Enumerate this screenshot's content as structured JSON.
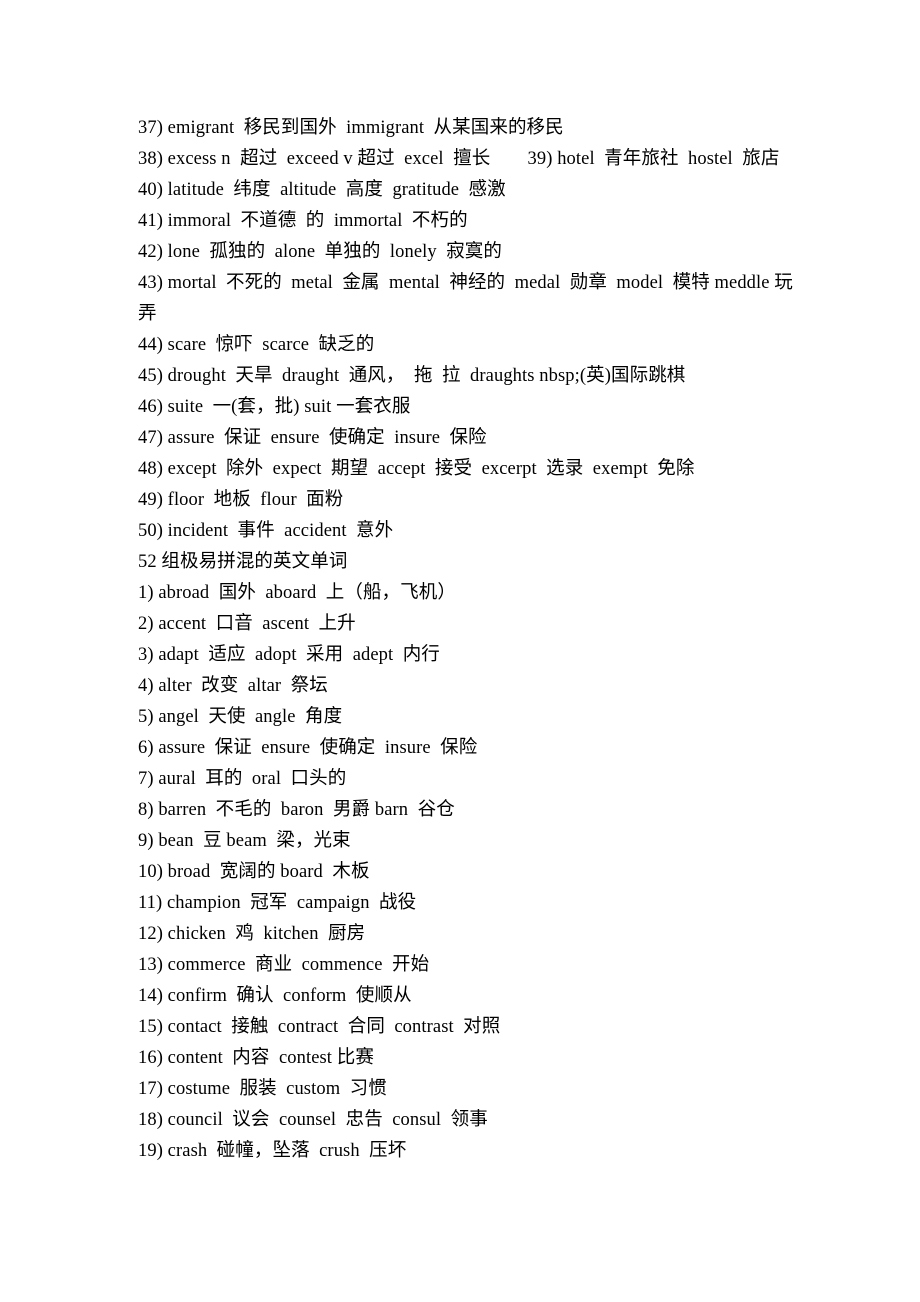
{
  "document": {
    "type": "vocabulary-study-notes",
    "language": "zh-CN/en",
    "sections": [
      {
        "id": "section-continued",
        "heading": null,
        "entries": [
          {
            "num": "37)",
            "text": "37) emigrant  移民到国外  immigrant  从某国来的移民"
          },
          {
            "num": "38)",
            "text": "38) excess n  超过  exceed v 超过  excel  擅长　　39) hotel  青年旅社  hostel  旅店"
          },
          {
            "num": "40)",
            "text": "40) latitude  纬度  altitude  高度  gratitude  感激"
          },
          {
            "num": "41)",
            "text": "41) immoral  不道德  的  immortal  不朽的"
          },
          {
            "num": "42)",
            "text": "42) lone  孤独的  alone  单独的  lonely  寂寞的"
          },
          {
            "num": "43)",
            "text": "43) mortal  不死的  metal  金属  mental  神经的  medal  勋章  model  模特 meddle 玩弄"
          },
          {
            "num": "44)",
            "text": "44) scare  惊吓  scarce  缺乏的"
          },
          {
            "num": "45)",
            "text": "45) drought  天旱  draught  通风，  拖  拉  draughts nbsp;(英)国际跳棋"
          },
          {
            "num": "46)",
            "text": "46) suite  一(套，批) suit 一套衣服"
          },
          {
            "num": "47)",
            "text": "47) assure  保证  ensure  使确定  insure  保险"
          },
          {
            "num": "48)",
            "text": "48) except  除外  expect  期望  accept  接受  excerpt  选录  exempt  免除"
          },
          {
            "num": "49)",
            "text": "49) floor  地板  flour  面粉"
          },
          {
            "num": "50)",
            "text": "50) incident  事件  accident  意外"
          }
        ]
      },
      {
        "id": "section-52-groups",
        "heading": "52 组极易拼混的英文单词",
        "entries": [
          {
            "num": "1)",
            "text": "1) abroad  国外  aboard  上（船，飞机）"
          },
          {
            "num": "2)",
            "text": "2) accent  口音  ascent  上升"
          },
          {
            "num": "3)",
            "text": "3) adapt  适应  adopt  采用  adept  内行"
          },
          {
            "num": "4)",
            "text": "4) alter  改变  altar  祭坛"
          },
          {
            "num": "5)",
            "text": "5) angel  天使  angle  角度"
          },
          {
            "num": "6)",
            "text": "6) assure  保证  ensure  使确定  insure  保险"
          },
          {
            "num": "7)",
            "text": "7) aural  耳的  oral  口头的"
          },
          {
            "num": "8)",
            "text": "8) barren  不毛的  baron  男爵 barn  谷仓"
          },
          {
            "num": "9)",
            "text": "9) bean  豆 beam  梁，光束"
          },
          {
            "num": "10)",
            "text": "10) broad  宽阔的 board  木板"
          },
          {
            "num": "11)",
            "text": "11) champion  冠军  campaign  战役"
          },
          {
            "num": "12)",
            "text": "12) chicken  鸡  kitchen  厨房"
          },
          {
            "num": "13)",
            "text": "13) commerce  商业  commence  开始"
          },
          {
            "num": "14)",
            "text": "14) confirm  确认  conform  使顺从"
          },
          {
            "num": "15)",
            "text": "15) contact  接触  contract  合同  contrast  对照"
          },
          {
            "num": "16)",
            "text": "16) content  内容  contest 比赛"
          },
          {
            "num": "17)",
            "text": "17) costume  服装  custom  习惯"
          },
          {
            "num": "18)",
            "text": "18) council  议会  counsel  忠告  consul  领事"
          },
          {
            "num": "19)",
            "text": "19) crash  碰幢，坠落  crush  压坏"
          }
        ]
      }
    ]
  }
}
